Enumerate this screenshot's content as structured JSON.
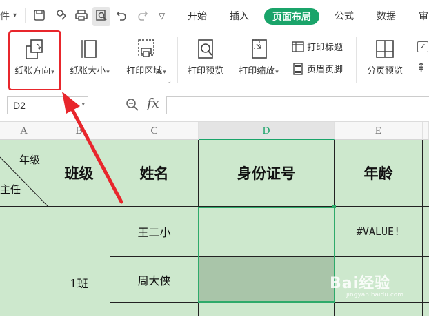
{
  "tabbar": {
    "file_fragment": "件",
    "tabs": [
      "开始",
      "插入",
      "页面布局",
      "公式",
      "数据",
      "审"
    ],
    "active_tab": "页面布局"
  },
  "ribbon": {
    "paper_orientation": "纸张方向",
    "paper_size": "纸张大小",
    "print_area": "打印区域",
    "print_preview": "打印预览",
    "print_scaling": "打印缩放",
    "print_titles": "打印标题",
    "header_footer": "页眉页脚",
    "page_break_preview": "分页预览"
  },
  "formula_bar": {
    "name_box": "D2",
    "fx_label": "fx",
    "value": ""
  },
  "columns": [
    "A",
    "B",
    "C",
    "D",
    "E"
  ],
  "selected_column": "D",
  "table": {
    "diag_top": "年级",
    "diag_bottom": "主任",
    "headers": {
      "B": "班级",
      "C": "姓名",
      "D": "身份证号",
      "E": "年龄"
    },
    "class_value": "1班",
    "rows": [
      {
        "name": "王二小",
        "age": "#VALUE!"
      },
      {
        "name": "周大侠",
        "age": ""
      }
    ]
  },
  "annotation": {
    "highlight_color": "#e8262c"
  },
  "accent_color": "#1aa46a",
  "watermark": {
    "text": "Bai经验",
    "sub": "jingyan.baidu.com"
  }
}
